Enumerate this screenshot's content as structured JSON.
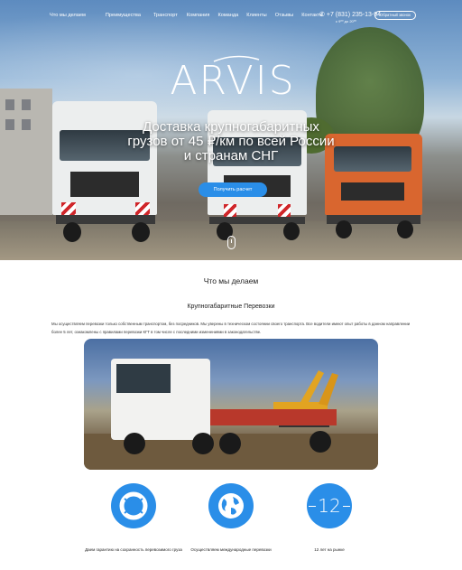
{
  "nav": {
    "items": [
      "Что мы делаем",
      "Преимущества",
      "Транспорт",
      "Компания",
      "Команда",
      "Клиенты",
      "Отзывы",
      "Контакты"
    ]
  },
  "contact": {
    "phone": "+7 (831) 235-13-94",
    "hours": "с 9⁰⁰ до 20⁰⁰",
    "callback_label": "Обратный звонок"
  },
  "hero": {
    "logo": "ARVIS",
    "headline": "Доставка крупногабаритных грузов от 45 ₽/км по всей России и странам СНГ",
    "cta_label": "Получить расчет"
  },
  "services": {
    "title": "Что мы делаем",
    "subtitle": "Крупногабаритные Перевозки",
    "text": "Мы осуществляем перевозки только собственным транспортом, без посредников. Мы уверены в техническом состоянии своего транспорта. Все водители имеют опыт работы в данном направлении более 5 лет, ознакомлены с правилами перевозки КГТ в том числе с последними изменениями в законодательстве."
  },
  "features": [
    {
      "icon": "lifebuoy-icon",
      "label": "Даем гарантию на сохранность перевозимого груза"
    },
    {
      "icon": "globe-icon",
      "label": "Осуществляем международные перевозки"
    },
    {
      "number": "12",
      "label": "12 лет на рынке"
    }
  ],
  "colors": {
    "accent": "#2a8ee8",
    "text": "#222222"
  }
}
